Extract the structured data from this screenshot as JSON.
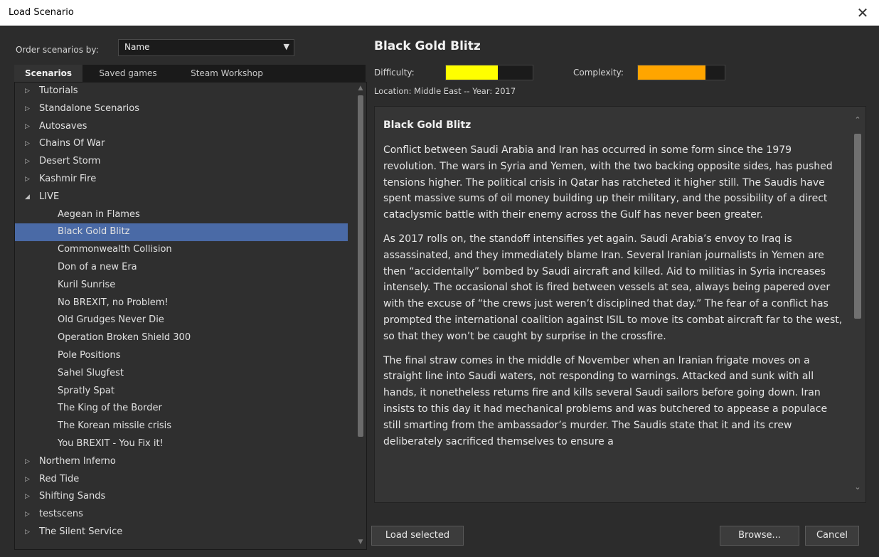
{
  "window": {
    "title": "Load Scenario",
    "close_icon": "close-icon"
  },
  "order": {
    "label": "Order scenarios by:",
    "value": "Name"
  },
  "tabs": [
    {
      "label": "Scenarios",
      "active": true
    },
    {
      "label": "Saved games",
      "active": false
    },
    {
      "label": "Steam Workshop",
      "active": false
    }
  ],
  "tree": [
    {
      "label": "Tutorials",
      "type": "group",
      "expanded": false
    },
    {
      "label": "Standalone Scenarios",
      "type": "group",
      "expanded": false
    },
    {
      "label": "Autosaves",
      "type": "group",
      "expanded": false
    },
    {
      "label": "Chains Of War",
      "type": "group",
      "expanded": false
    },
    {
      "label": "Desert Storm",
      "type": "group",
      "expanded": false
    },
    {
      "label": "Kashmir Fire",
      "type": "group",
      "expanded": false
    },
    {
      "label": "LIVE",
      "type": "group",
      "expanded": true
    },
    {
      "label": "Aegean in Flames",
      "type": "child"
    },
    {
      "label": "Black Gold Blitz",
      "type": "child",
      "selected": true
    },
    {
      "label": "Commonwealth Collision",
      "type": "child"
    },
    {
      "label": "Don of a new Era",
      "type": "child"
    },
    {
      "label": "Kuril Sunrise",
      "type": "child"
    },
    {
      "label": "No BREXIT, no Problem!",
      "type": "child"
    },
    {
      "label": "Old Grudges Never Die",
      "type": "child"
    },
    {
      "label": "Operation Broken Shield 300",
      "type": "child"
    },
    {
      "label": "Pole Positions",
      "type": "child"
    },
    {
      "label": "Sahel Slugfest",
      "type": "child"
    },
    {
      "label": "Spratly Spat",
      "type": "child"
    },
    {
      "label": "The King of the Border",
      "type": "child"
    },
    {
      "label": "The Korean missile crisis",
      "type": "child"
    },
    {
      "label": "You BREXIT - You Fix it!",
      "type": "child"
    },
    {
      "label": "Northern Inferno",
      "type": "group",
      "expanded": false
    },
    {
      "label": "Red Tide",
      "type": "group",
      "expanded": false
    },
    {
      "label": "Shifting Sands",
      "type": "group",
      "expanded": false
    },
    {
      "label": "testscens",
      "type": "group",
      "expanded": false
    },
    {
      "label": "The Silent Service",
      "type": "group",
      "expanded": false
    }
  ],
  "scenario": {
    "title": "Black Gold Blitz",
    "difficulty_label": "Difficulty:",
    "difficulty": 0.6,
    "complexity_label": "Complexity:",
    "complexity": 0.78,
    "difficulty_color": "#ffff00",
    "complexity_color": "#ffa500",
    "location": "Location: Middle East  --  Year: 2017",
    "desc_title": "Black Gold Blitz",
    "paragraphs": [
      "Conflict between Saudi Arabia and Iran has occurred in some form since the 1979 revolution. The wars in Syria and Yemen, with the two backing opposite sides, has pushed tensions higher. The political crisis in Qatar has ratcheted it higher still. The Saudis have spent massive sums of oil money building up their military, and the possibility of a direct cataclysmic battle with their enemy across the Gulf has never been greater.",
      "As 2017 rolls on, the standoff intensifies yet again. Saudi Arabia’s envoy to Iraq is assassinated, and they immediately blame Iran. Several Iranian journalists in Yemen are then “accidentally” bombed by Saudi aircraft and killed. Aid to militias in Syria increases intensely. The occasional shot is fired between vessels at sea, always being papered over with the excuse of “the crews just weren’t disciplined that day.” The fear of a conflict has prompted the international coalition against ISIL to move its combat aircraft far to the west, so that they won’t be caught by surprise in the crossfire.",
      "The final straw comes in the middle of November when an Iranian frigate moves on a straight line into Saudi waters, not responding to warnings. Attacked and sunk with all hands, it nonetheless returns fire and kills several Saudi sailors before going down. Iran insists to this day it had mechanical problems and was butchered to appease a populace still smarting from the ambassador’s murder. The Saudis state that it and its crew deliberately sacrificed themselves to ensure a"
    ]
  },
  "buttons": {
    "load": "Load selected",
    "browse": "Browse...",
    "cancel": "Cancel"
  }
}
